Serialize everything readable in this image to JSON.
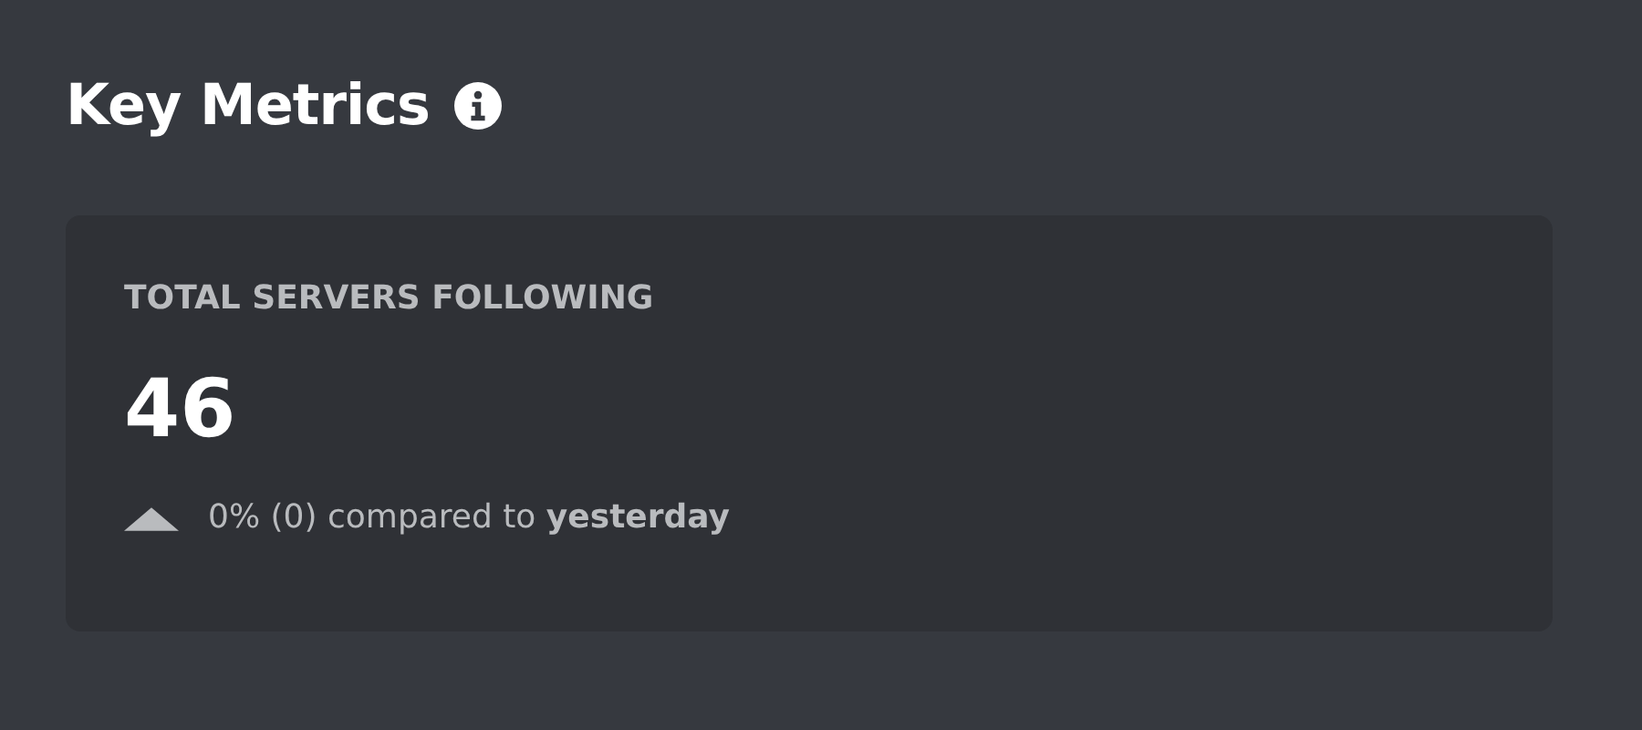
{
  "title": "Key Metrics",
  "metric": {
    "label": "TOTAL SERVERS FOLLOWING",
    "value": "46",
    "kind": "up",
    "change": "0% (0) compared to **yesterday**"
  }
}
